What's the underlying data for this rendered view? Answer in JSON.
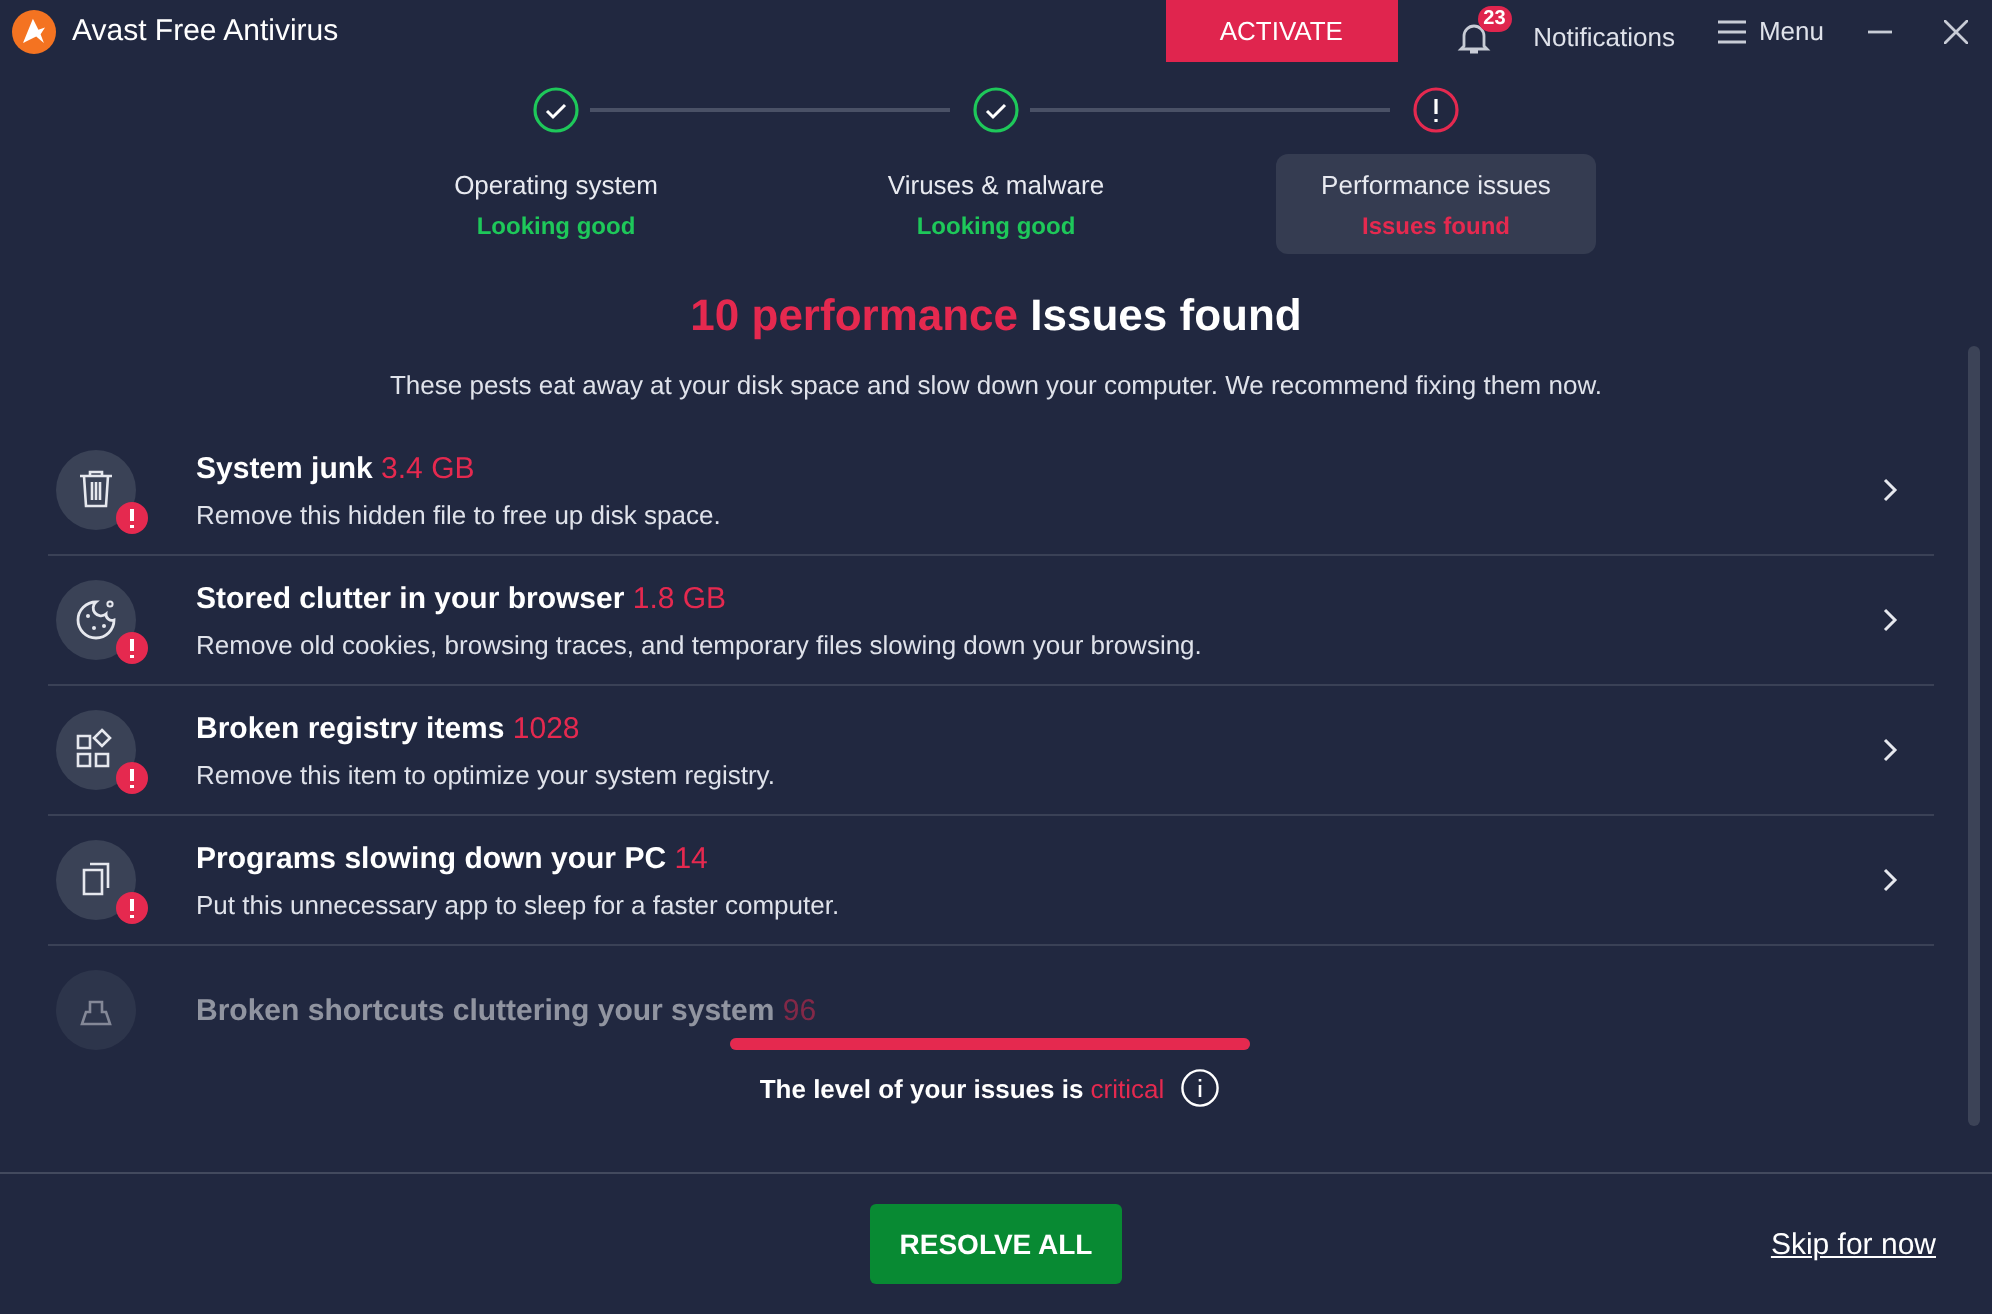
{
  "window": {
    "title": "Avast Free Antivirus"
  },
  "header": {
    "activate": "ACTIVATE",
    "notifications": {
      "label": "Notifications",
      "count": "23"
    },
    "menu": "Menu"
  },
  "steps": [
    {
      "label": "Operating system",
      "status_text": "Looking good",
      "passed": true,
      "selected": false
    },
    {
      "label": "Viruses & malware",
      "status_text": "Looking good",
      "passed": true,
      "selected": false
    },
    {
      "label": "Performance issues",
      "status_text": "Issues found",
      "passed": false,
      "selected": true
    }
  ],
  "heading": {
    "count": "10 performance",
    "rest": "Issues found"
  },
  "subtitle": "These pests eat away at your disk space and slow down your computer. We recommend fixing them now.",
  "issues": [
    {
      "kind": "trash",
      "title": "System junk",
      "value": "3.4 GB",
      "description": "Remove this hidden file to free up disk space.",
      "faded": false
    },
    {
      "kind": "cookie",
      "title": "Stored clutter in your browser",
      "value": "1.8 GB",
      "description": "Remove old cookies, browsing traces, and temporary files slowing down your browsing.",
      "faded": false
    },
    {
      "kind": "registry",
      "title": "Broken registry items",
      "value": "1028",
      "description": "Remove this item to optimize your system registry.",
      "faded": false
    },
    {
      "kind": "apps",
      "title": "Programs slowing down your PC",
      "value": "14",
      "description": "Put this unnecessary app to sleep for a faster computer.",
      "faded": false
    },
    {
      "kind": "shortcut",
      "title": "Broken shortcuts cluttering your system",
      "value": "96",
      "faded": true
    }
  ],
  "issue_level": {
    "level": 1,
    "text": "The level of your issues is",
    "value": "critical"
  },
  "footer": {
    "primary": "RESOLVE ALL",
    "skip": "Skip for now"
  }
}
